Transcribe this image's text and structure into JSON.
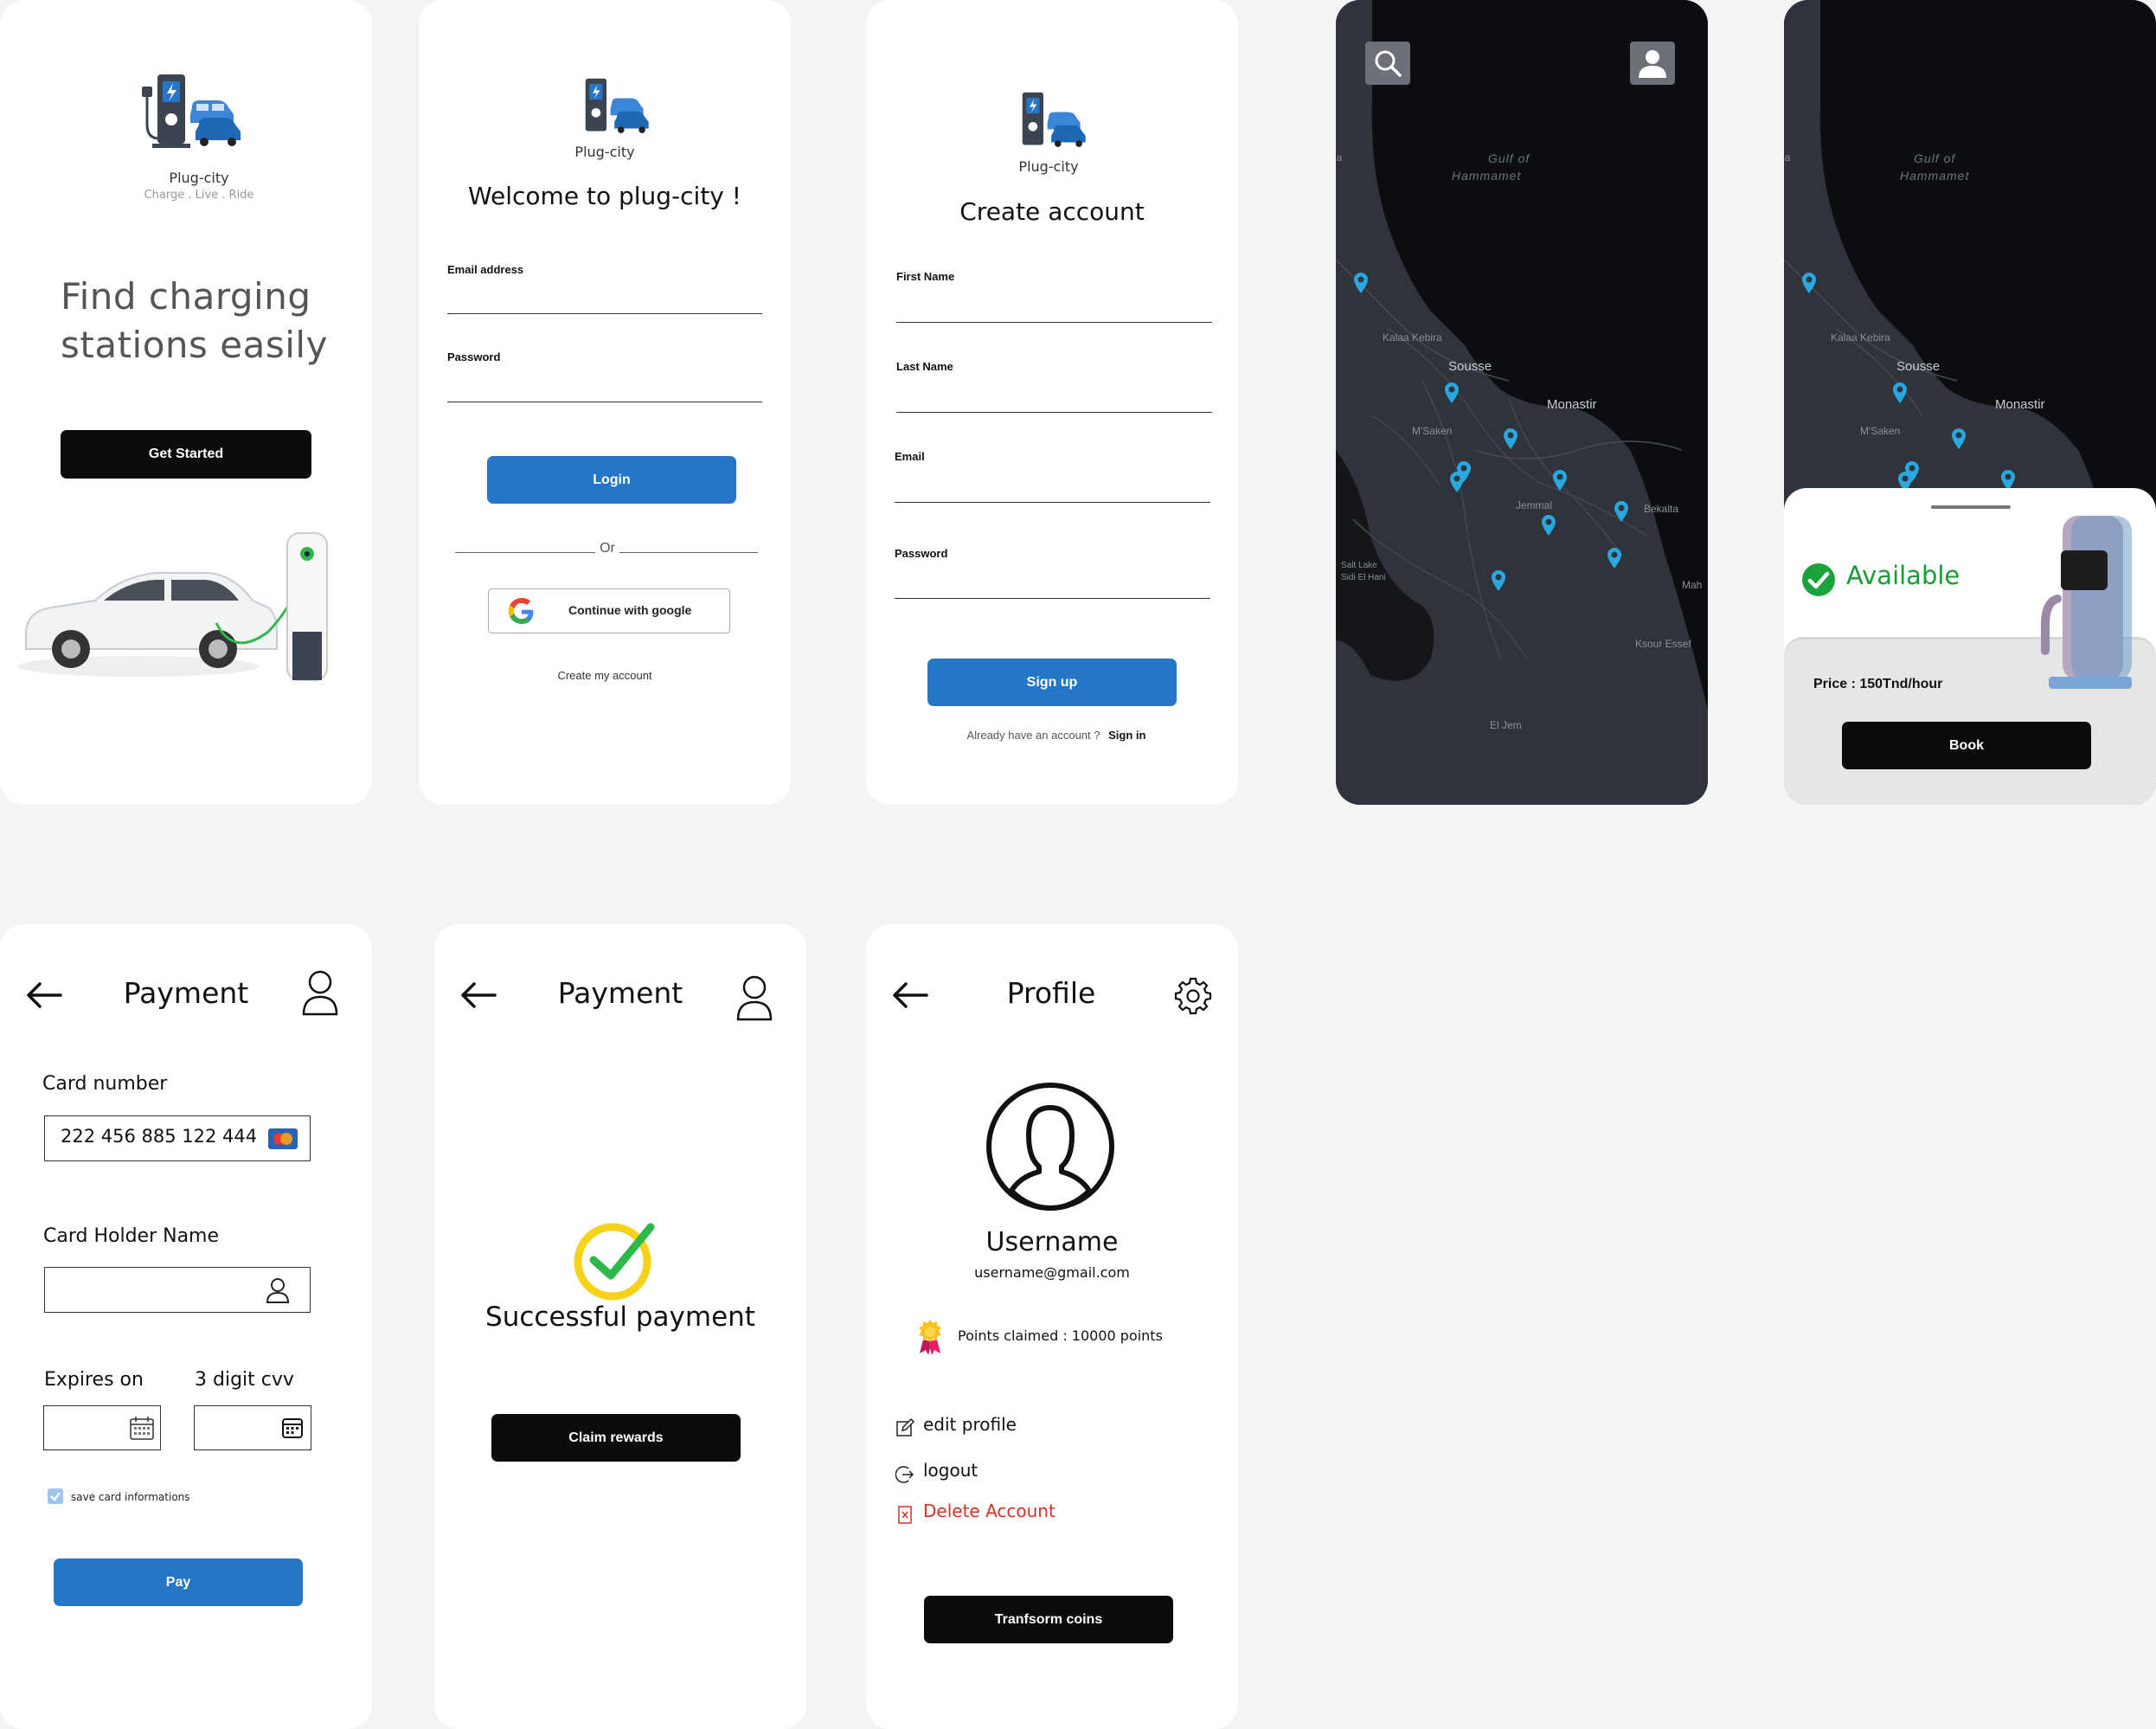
{
  "colors": {
    "background": "#f4f4f4",
    "primary_blue": "#2576c8",
    "black": "#0b0b0b",
    "map_dark": "#2b2f36",
    "success_green": "#1a9a38",
    "danger_red": "#d93025"
  },
  "brand": {
    "name": "Plug-city",
    "tagline": "Charge . Live . Ride"
  },
  "onboarding": {
    "headline_line1": "Find charging",
    "headline_line2": "stations easily",
    "cta_label": "Get Started"
  },
  "login": {
    "title": "Welcome to plug-city !",
    "email_label": "Email  address",
    "password_label": "Password",
    "login_label": "Login",
    "or_label": "Or",
    "google_label": "Continue with google",
    "create_account_link": "Create my account"
  },
  "signup": {
    "title": "Create account",
    "first_name_label": "First Name",
    "last_name_label": "Last Name",
    "email_label": "Email",
    "password_label": "Password",
    "signup_label": "Sign up",
    "already_text": "Already have an account ?",
    "signin_link": "Sign in"
  },
  "map": {
    "gulf_line1": "Gulf of",
    "gulf_line2": "Hammamet",
    "places": {
      "kalaa": "Kalaa Kebira",
      "sousse": "Sousse",
      "monastir": "Monastir",
      "msaken": "M'Saken",
      "jemmal": "Jemmal",
      "bekalta": "Bekalta",
      "ksour": "Ksour Essef",
      "eljem": "El Jem",
      "saltlake1": "Salt Lake",
      "saltlake2": "Sidi El Hani",
      "mah": "Mah",
      "na": "na"
    }
  },
  "booking": {
    "status": "Available",
    "price": "Price : 150Tnd/hour",
    "book_label": "Book"
  },
  "payment": {
    "title": "Payment",
    "card_number_label": "Card number",
    "card_number_value": "222 456 885 122 444",
    "holder_label": "Card Holder Name",
    "expires_label": "Expires on",
    "cvv_label": "3 digit cvv",
    "save_label": "save card informations",
    "save_checked": true,
    "pay_label": "Pay"
  },
  "success": {
    "title": "Payment",
    "message": "Successful payment",
    "claim_label": "Claim rewards"
  },
  "profile": {
    "title": "Profile",
    "username": "Username",
    "email": "username@gmail.com",
    "points": "Points claimed : 10000 points",
    "edit_label": "edit profile",
    "logout_label": "logout",
    "delete_label": "Delete Account",
    "transform_label": "Tranfsorm coins"
  }
}
